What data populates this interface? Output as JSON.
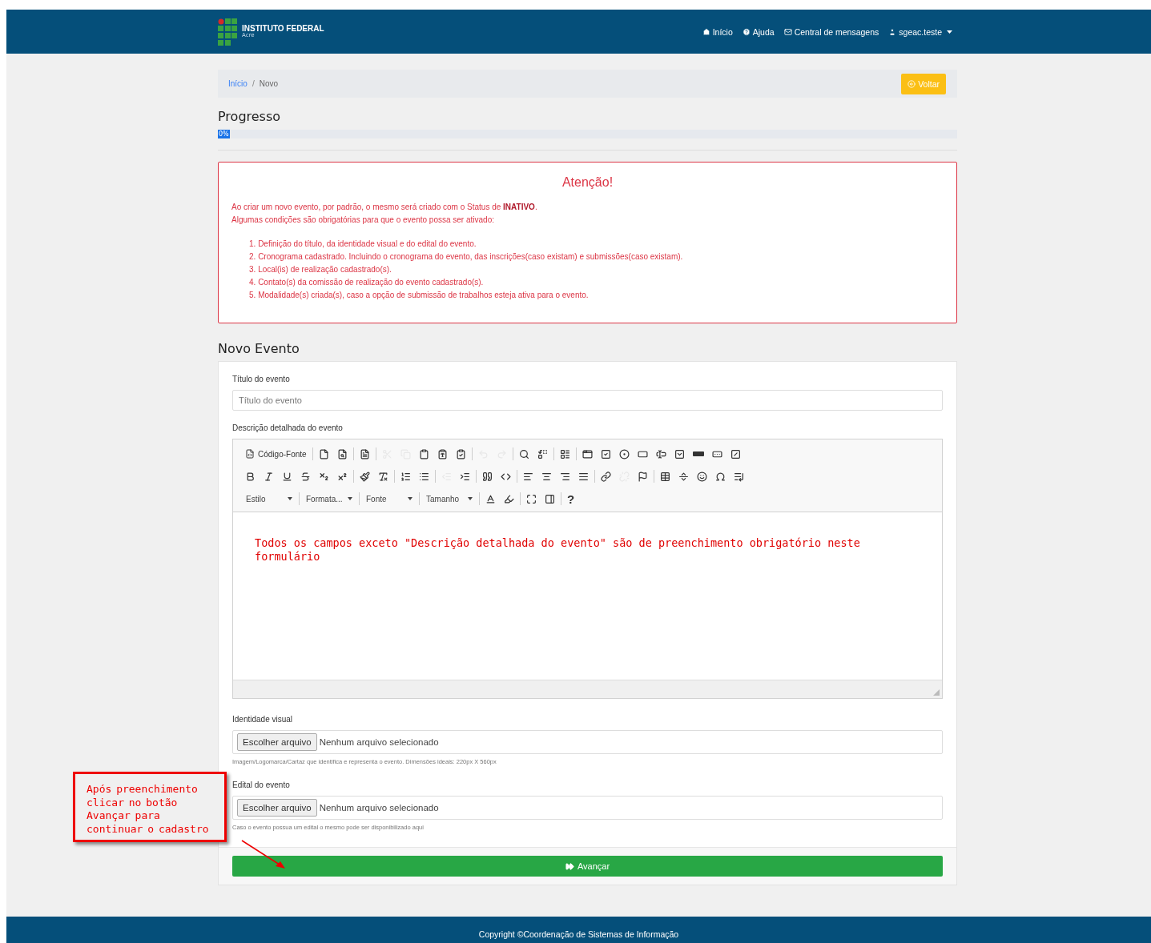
{
  "navbar": {
    "brand": "INSTITUTO FEDERAL",
    "brand_sub": "Acre",
    "links": [
      {
        "kind": "home",
        "label": "Início"
      },
      {
        "kind": "help",
        "label": "Ajuda"
      },
      {
        "kind": "mail",
        "label": "Central de mensagens"
      },
      {
        "kind": "user",
        "label": "sgeac.teste"
      }
    ]
  },
  "breadcrumb": {
    "items": [
      {
        "label": "Início",
        "link": true
      },
      {
        "label": "Novo",
        "link": false
      }
    ],
    "separator": "/",
    "back_button": "Voltar"
  },
  "progress": {
    "title": "Progresso",
    "level": 0,
    "label": "0%"
  },
  "alert": {
    "title": "Atenção!",
    "lines": [
      "Ao criar um novo evento, por padrão, o mesmo será criado com o Status de **INATIVO**.",
      "Algumas condições são obrigatórias para que o evento possa ser ativado:"
    ],
    "conditions": [
      {
        "number": "1.",
        "text": "Definição do título, da identidade visual e do edital do evento."
      },
      {
        "number": "2.",
        "text": "Cronograma cadastrado. Incluindo o cronograma do evento, das inscrições(caso existam) e submissões(caso existam)."
      },
      {
        "number": "3.",
        "text": "Local(is) de realização cadastrado(s)."
      },
      {
        "number": "4.",
        "text": "Contato(s) da comissão de realização do evento cadastrado(s)."
      },
      {
        "number": "5.",
        "text": "Modalidade(s) criada(s), caso a opção de submissão de trabalhos esteja ativa para o evento."
      }
    ]
  },
  "form": {
    "title": "Novo Evento",
    "title_field": {
      "label": "Título do evento",
      "placeholder": "Título do evento"
    },
    "description": {
      "label": "Descrição detalhada do evento",
      "toolbar": [
        [
          {
            "kind": "source",
            "label": "Código-Fonte",
            "disabled": false
          },
          {
            "kind": "separator"
          },
          {
            "kind": "new",
            "disabled": false
          },
          {
            "kind": "preview",
            "disabled": false
          },
          {
            "kind": "separator"
          },
          {
            "kind": "templates",
            "disabled": false
          },
          {
            "kind": "separator"
          },
          {
            "kind": "cut",
            "disabled": true
          },
          {
            "kind": "copy",
            "disabled": true
          },
          {
            "kind": "paste",
            "disabled": false
          },
          {
            "kind": "pastetext",
            "disabled": false
          },
          {
            "kind": "pasteword",
            "disabled": false
          },
          {
            "kind": "separator"
          },
          {
            "kind": "undo",
            "disabled": true
          },
          {
            "kind": "redo",
            "disabled": true
          },
          {
            "kind": "separator"
          },
          {
            "kind": "find",
            "disabled": false
          },
          {
            "kind": "replace",
            "disabled": false
          },
          {
            "kind": "separator"
          },
          {
            "kind": "selectall",
            "disabled": false
          },
          {
            "kind": "separator"
          },
          {
            "kind": "form",
            "disabled": false
          },
          {
            "kind": "checkbox",
            "disabled": false
          },
          {
            "kind": "radio",
            "disabled": false
          },
          {
            "kind": "textfield",
            "disabled": false
          },
          {
            "kind": "textarea",
            "disabled": false
          },
          {
            "kind": "select",
            "disabled": false
          },
          {
            "kind": "button",
            "disabled": false
          },
          {
            "kind": "imagebutton",
            "disabled": false
          },
          {
            "kind": "hiddenfield",
            "disabled": false
          }
        ],
        [
          {
            "kind": "bold",
            "disabled": false
          },
          {
            "kind": "italic",
            "disabled": false
          },
          {
            "kind": "underline",
            "disabled": false
          },
          {
            "kind": "strike",
            "disabled": false
          },
          {
            "kind": "subscript",
            "disabled": false
          },
          {
            "kind": "superscript",
            "disabled": false
          },
          {
            "kind": "separator"
          },
          {
            "kind": "copyformat",
            "disabled": false
          },
          {
            "kind": "removeformat",
            "disabled": false
          },
          {
            "kind": "separator"
          },
          {
            "kind": "numbered",
            "disabled": false
          },
          {
            "kind": "bulleted",
            "disabled": false
          },
          {
            "kind": "separator"
          },
          {
            "kind": "outdent",
            "disabled": true
          },
          {
            "kind": "indent",
            "disabled": false
          },
          {
            "kind": "separator"
          },
          {
            "kind": "blockquote",
            "disabled": false
          },
          {
            "kind": "div",
            "disabled": false
          },
          {
            "kind": "separator"
          },
          {
            "kind": "alignleft",
            "disabled": false
          },
          {
            "kind": "aligncenter",
            "disabled": false
          },
          {
            "kind": "alignright",
            "disabled": false
          },
          {
            "kind": "justify",
            "disabled": false
          },
          {
            "kind": "separator"
          },
          {
            "kind": "link",
            "disabled": false
          },
          {
            "kind": "unlink",
            "disabled": true
          },
          {
            "kind": "anchor",
            "disabled": false
          },
          {
            "kind": "separator"
          },
          {
            "kind": "table",
            "disabled": false
          },
          {
            "kind": "rule",
            "disabled": false
          },
          {
            "kind": "smiley",
            "disabled": false
          },
          {
            "kind": "specialchar",
            "disabled": false
          },
          {
            "kind": "pagebreak",
            "disabled": false
          }
        ],
        [
          {
            "kind": "dropdown",
            "label": "Estilo"
          },
          {
            "kind": "separator"
          },
          {
            "kind": "dropdown",
            "label": "Formata..."
          },
          {
            "kind": "separator"
          },
          {
            "kind": "dropdown",
            "label": "Fonte"
          },
          {
            "kind": "separator"
          },
          {
            "kind": "dropdown",
            "label": "Tamanho"
          },
          {
            "kind": "separator"
          },
          {
            "kind": "textcolor",
            "disabled": false
          },
          {
            "kind": "bgcolor",
            "disabled": false
          },
          {
            "kind": "separator"
          },
          {
            "kind": "maximize",
            "disabled": false
          },
          {
            "kind": "showblocks",
            "disabled": false
          },
          {
            "kind": "separator"
          },
          {
            "kind": "about",
            "label": "?",
            "disabled": false
          }
        ]
      ],
      "content": "Todos os campos exceto \"Descrição detalhada do evento\" são de preenchimento obrigatório neste formulário"
    },
    "files": [
      {
        "label": "Identidade visual",
        "button": "Escolher arquivo",
        "value": "Nenhum arquivo selecionado",
        "help": "Imagem/Logomarca/Cartaz que identifica e representa o evento. Dimensões ideais: 220px X 560px"
      },
      {
        "label": "Edital do evento",
        "button": "Escolher arquivo",
        "value": "Nenhum arquivo selecionado",
        "help": "Caso o evento possua um edital o mesmo pode ser disponibilizado aqui"
      }
    ],
    "submit": "Avançar"
  },
  "annotation": {
    "text": "Após preenchimento clicar no botão Avançar para continuar o cadastro"
  },
  "footer": "Copyright ©Coordenação de Sistemas de Informação"
}
